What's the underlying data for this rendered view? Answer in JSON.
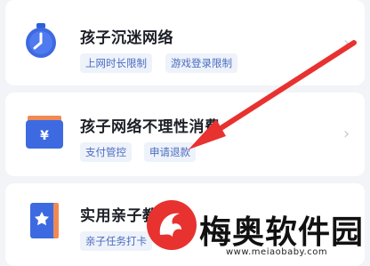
{
  "items": [
    {
      "title": "孩子沉迷网络",
      "icon": "alarm-clock-icon",
      "tags": [
        "上网时长限制",
        "游戏登录限制"
      ]
    },
    {
      "title": "孩子网络不理性消费",
      "icon": "yuan-wallet-icon",
      "tags": [
        "支付管控",
        "申请退款"
      ]
    },
    {
      "title": "实用亲子教育",
      "icon": "star-book-icon",
      "tags": [
        "亲子任务打卡"
      ]
    }
  ],
  "watermark": {
    "name": "梅奥软件园",
    "url": "www.meiaobaby.com"
  },
  "colors": {
    "accent": "#3d6ae0",
    "wallet": "#e8553f",
    "tag_bg": "#eef2fa",
    "tag_text": "#4a6cc0",
    "arrow": "#e8322f"
  }
}
